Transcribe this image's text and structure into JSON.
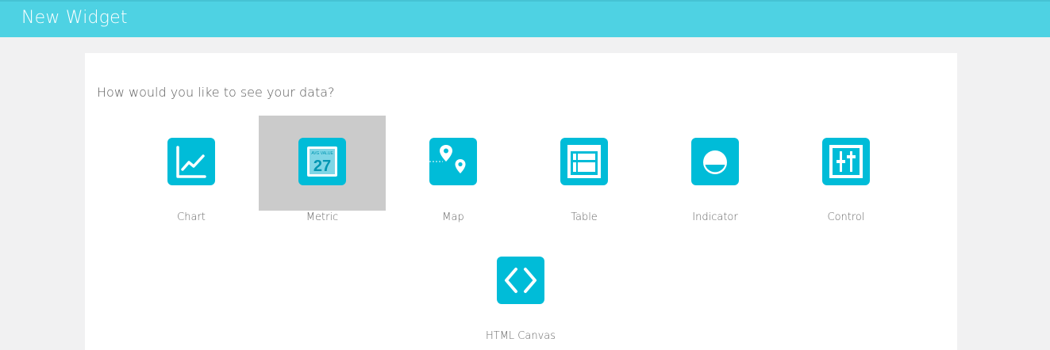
{
  "header": {
    "title": "New Widget"
  },
  "panel": {
    "question": "How would you like to see your data?"
  },
  "widgets": [
    {
      "label": "Chart"
    },
    {
      "label": "Metric",
      "icon_caption": "AVG VALUE",
      "icon_value": "27"
    },
    {
      "label": "Map"
    },
    {
      "label": "Table"
    },
    {
      "label": "Indicator"
    },
    {
      "label": "Control"
    },
    {
      "label": "HTML Canvas"
    }
  ],
  "colors": {
    "header_bg": "#4ed2e3",
    "icon_bg": "#00bcd8",
    "selected_bg": "#cbcbcb",
    "page_bg": "#f1f1f2"
  },
  "selected_widget": "Metric"
}
